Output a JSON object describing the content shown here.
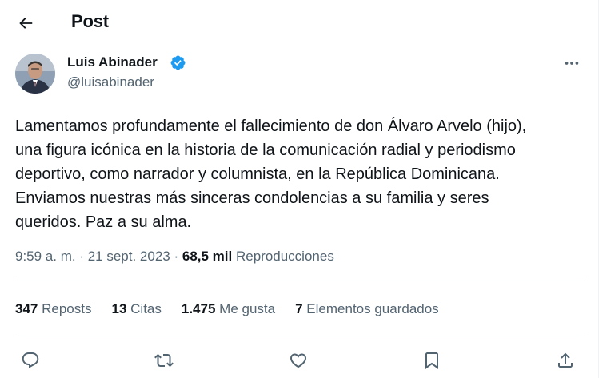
{
  "header": {
    "title": "Post",
    "back_icon": "arrow-left-icon"
  },
  "author": {
    "name": "Luis Abinader",
    "handle": "@luisabinader",
    "verified_icon": "verified-badge-icon",
    "verified_color": "#1d9bf0"
  },
  "tweet": {
    "text": "Lamentamos profundamente el fallecimiento de don Álvaro Arvelo (hijo),\nuna figura icónica en la historia de la comunicación radial y periodismo\ndeportivo, como narrador y columnista, en la República Dominicana.\nEnviamos nuestras más sinceras condolencias a su familia y seres\nqueridos. Paz a su alma."
  },
  "meta": {
    "time": "9:59 a. m.",
    "separator": " · ",
    "date": "21 sept. 2023",
    "views_count": "68,5 mil",
    "views_label": "Reproducciones"
  },
  "stats": {
    "reposts": {
      "num": "347",
      "label": "Reposts"
    },
    "quotes": {
      "num": "13",
      "label": "Citas"
    },
    "likes": {
      "num": "1.475",
      "label": "Me gusta"
    },
    "bookmarks": {
      "num": "7",
      "label": "Elementos guardados"
    }
  },
  "actions": [
    "reply-icon",
    "repost-icon",
    "like-icon",
    "bookmark-icon",
    "share-icon"
  ],
  "colors": {
    "text": "#0f1419",
    "secondary": "#536471",
    "divider": "#eff3f4",
    "accent": "#1d9bf0"
  }
}
